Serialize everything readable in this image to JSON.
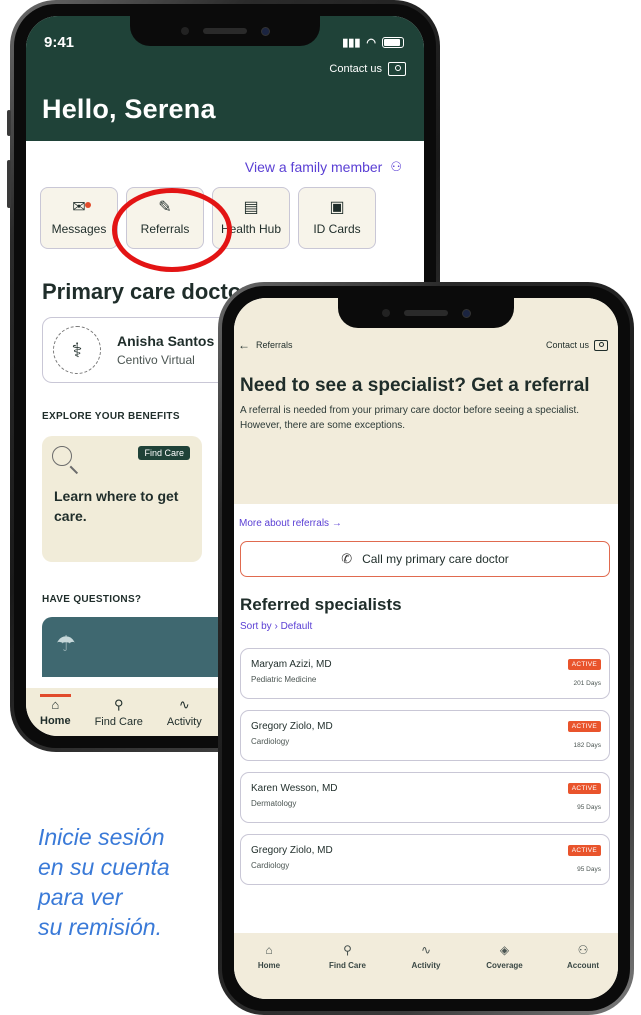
{
  "phone1": {
    "status": {
      "time": "9:41"
    },
    "header": {
      "contact_label": "Contact us",
      "greeting": "Hello, Serena"
    },
    "family_link": "View a family member",
    "tiles": [
      {
        "label": "Messages",
        "icon": "envelope-icon"
      },
      {
        "label": "Referrals",
        "icon": "pencil-icon"
      },
      {
        "label": "Health Hub",
        "icon": "document-icon"
      },
      {
        "label": "ID Cards",
        "icon": "id-card-icon"
      }
    ],
    "primary_care_title": "Primary care doctor",
    "doctor": {
      "name": "Anisha Santos",
      "subtitle": "Centivo Virtual"
    },
    "explore_label": "EXPLORE YOUR BENEFITS",
    "benefit_card": {
      "badge": "Find Care",
      "text": "Learn where to get care."
    },
    "questions_label": "HAVE QUESTIONS?",
    "bottom_nav": [
      {
        "label": "Home",
        "icon": "home-icon",
        "active": true
      },
      {
        "label": "Find Care",
        "icon": "search-icon"
      },
      {
        "label": "Activity",
        "icon": "activity-icon"
      }
    ]
  },
  "phone2": {
    "topbar": {
      "back_label": "Referrals",
      "contact_label": "Contact us"
    },
    "title": "Need to see a specialist? Get a referral",
    "description": "A referral is needed from your primary care doctor before seeing a specialist. However, there are some exceptions.",
    "more_link": "More about referrals",
    "call_button": "Call my primary care doctor",
    "specialists_title": "Referred specialists",
    "sort": {
      "label": "Sort by",
      "value": "Default"
    },
    "referrals": [
      {
        "name": "Maryam Azizi, MD",
        "specialty": "Pediatric Medicine",
        "status": "ACTIVE",
        "days": "201 Days"
      },
      {
        "name": "Gregory Ziolo, MD",
        "specialty": "Cardiology",
        "status": "ACTIVE",
        "days": "182 Days"
      },
      {
        "name": "Karen Wesson, MD",
        "specialty": "Dermatology",
        "status": "ACTIVE",
        "days": "95 Days"
      },
      {
        "name": "Gregory Ziolo, MD",
        "specialty": "Cardiology",
        "status": "ACTIVE",
        "days": "95 Days"
      }
    ],
    "bottom_nav": [
      {
        "label": "Home",
        "icon": "home-icon"
      },
      {
        "label": "Find Care",
        "icon": "search-icon"
      },
      {
        "label": "Activity",
        "icon": "activity-icon"
      },
      {
        "label": "Coverage",
        "icon": "shield-icon"
      },
      {
        "label": "Account",
        "icon": "account-icon"
      }
    ]
  },
  "caption": [
    "Inicie sesión",
    "en su cuenta",
    "para ver",
    "su remisión."
  ],
  "colors": {
    "brand_green": "#1f4238",
    "accent_red": "#e9542c",
    "link_purple": "#5a3fd4",
    "cream": "#f2ecdb",
    "highlight_circle": "#e31414",
    "caption_blue": "#3a7ad8"
  }
}
